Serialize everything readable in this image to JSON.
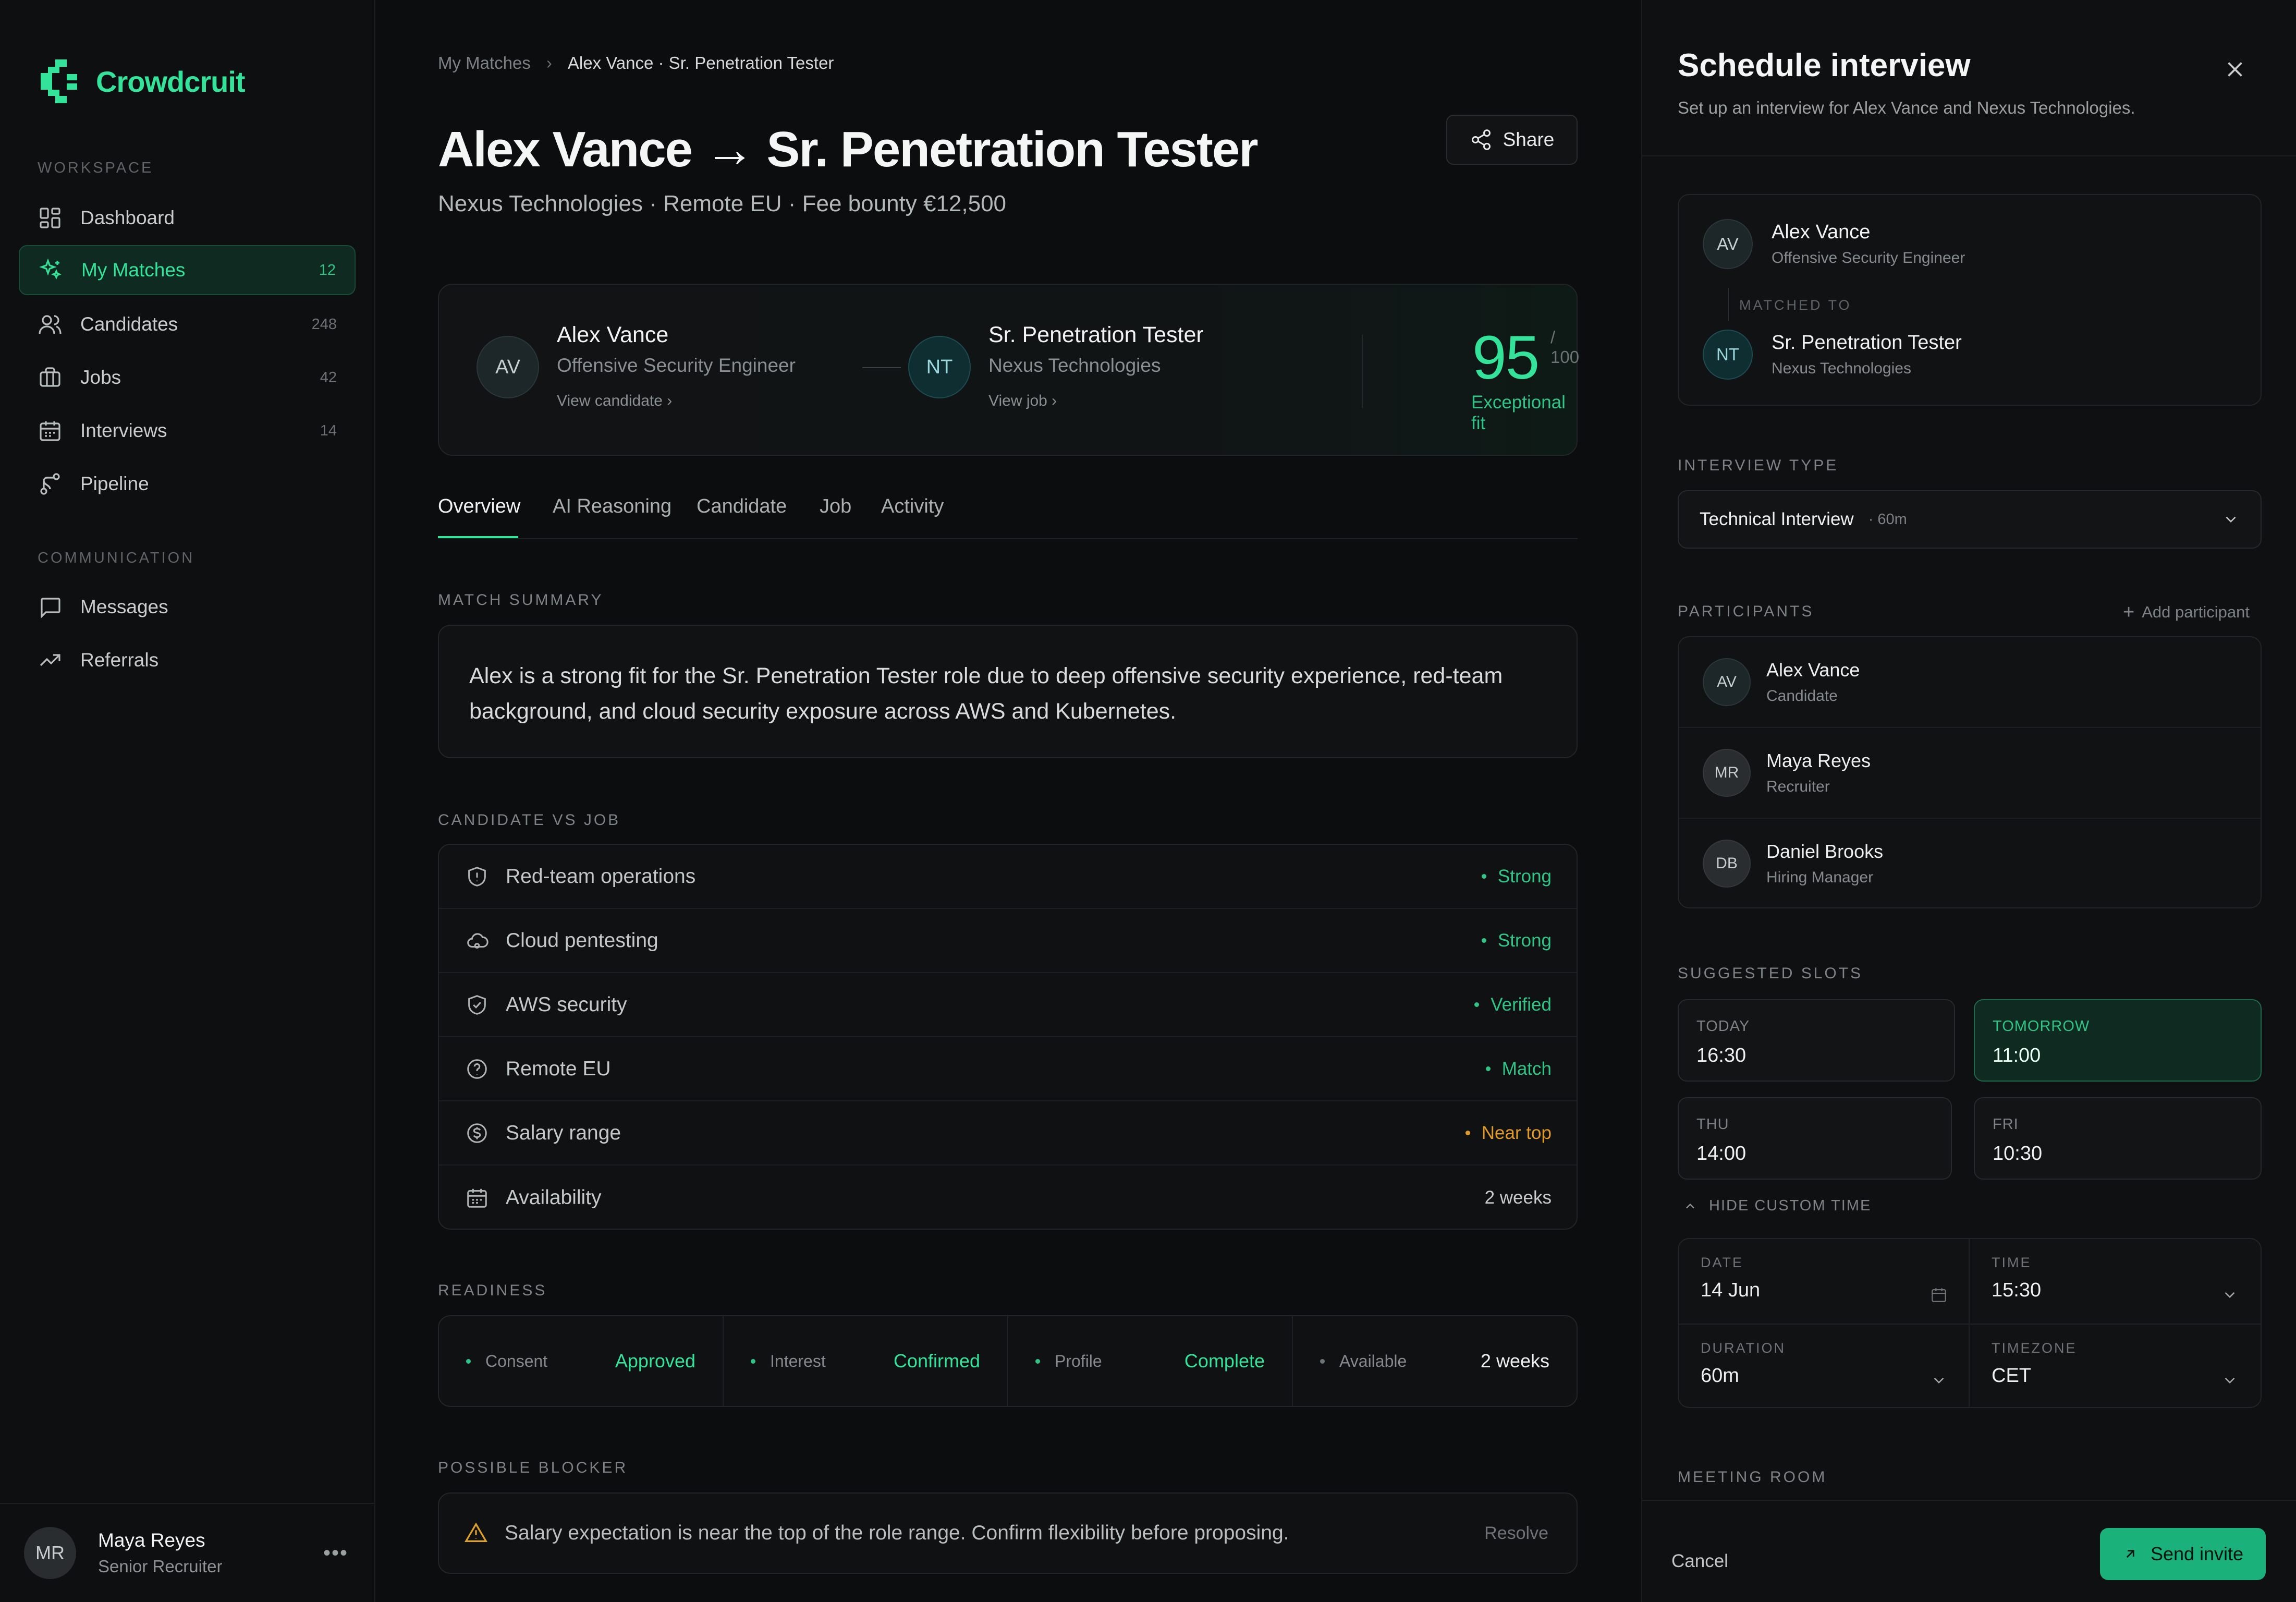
{
  "app": {
    "name": "Crowdcruit",
    "accent": "#34e39a"
  },
  "sidebar": {
    "workspace_label": "WORKSPACE",
    "communication_label": "COMMUNICATION",
    "items": [
      {
        "label": "Dashboard",
        "icon": "dashboard-icon",
        "count": ""
      },
      {
        "label": "My Matches",
        "icon": "sparkle-icon",
        "count": "12"
      },
      {
        "label": "Candidates",
        "icon": "users-icon",
        "count": "248"
      },
      {
        "label": "Jobs",
        "icon": "briefcase-icon",
        "count": "42"
      },
      {
        "label": "Interviews",
        "icon": "calendar-icon",
        "count": "14"
      },
      {
        "label": "Pipeline",
        "icon": "pipeline-icon",
        "count": ""
      }
    ],
    "comm_items": [
      {
        "label": "Messages",
        "icon": "message-icon"
      },
      {
        "label": "Referrals",
        "icon": "trend-icon"
      }
    ],
    "user": {
      "initials": "MR",
      "name": "Maya Reyes",
      "role": "Senior Recruiter",
      "more": "•••"
    }
  },
  "main": {
    "breadcrumb": {
      "parent": "My Matches",
      "sep": "›",
      "current": "Alex Vance · Sr. Penetration Tester"
    },
    "title": "Alex Vance → Sr. Penetration Tester",
    "subtitle": "Nexus Technologies · Remote EU · Fee bounty €12,500",
    "share_label": "Share",
    "match": {
      "candidate": {
        "initials": "AV",
        "name": "Alex Vance",
        "role": "Offensive Security Engineer",
        "link": "View candidate ›"
      },
      "job": {
        "initials": "NT",
        "name": "Sr. Penetration Tester",
        "company": "Nexus Technologies",
        "link": "View job ›"
      },
      "score": "95",
      "out_of": "/ 100",
      "fit": "Exceptional fit"
    },
    "tabs": [
      "Overview",
      "AI Reasoning",
      "Candidate",
      "Job",
      "Activity"
    ],
    "summary_label": "MATCH SUMMARY",
    "summary": "Alex is a strong fit for the Sr. Penetration Tester role due to deep offensive security experience, red-team background, and cloud security exposure across AWS and Kubernetes.",
    "cvj_label": "CANDIDATE VS JOB",
    "cvj": [
      {
        "label": "Red-team operations",
        "value": "Strong",
        "status": "green",
        "icon": "shield-alert-icon"
      },
      {
        "label": "Cloud pentesting",
        "value": "Strong",
        "status": "green",
        "icon": "cloud-icon"
      },
      {
        "label": "AWS security",
        "value": "Verified",
        "status": "green",
        "icon": "shield-check-icon"
      },
      {
        "label": "Remote EU",
        "value": "Match",
        "status": "green",
        "icon": "help-circle-icon"
      },
      {
        "label": "Salary range",
        "value": "Near top",
        "status": "amber",
        "icon": "dollar-icon"
      },
      {
        "label": "Availability",
        "value": "2 weeks",
        "status": "neutral",
        "icon": "calendar-icon"
      }
    ],
    "readiness_label": "READINESS",
    "readiness": [
      {
        "key": "Consent",
        "value": "Approved",
        "tone": "green"
      },
      {
        "key": "Interest",
        "value": "Confirmed",
        "tone": "green"
      },
      {
        "key": "Profile",
        "value": "Complete",
        "tone": "green"
      },
      {
        "key": "Available",
        "value": "2 weeks",
        "tone": "white"
      }
    ],
    "blocker_label": "POSSIBLE BLOCKER",
    "blocker": {
      "text": "Salary expectation is near the top of the role range. Confirm flexibility before proposing.",
      "action": "Resolve"
    }
  },
  "panel": {
    "title": "Schedule interview",
    "subtitle": "Set up an interview for Alex Vance and Nexus Technologies.",
    "match": {
      "a": {
        "initials": "AV",
        "name": "Alex Vance",
        "role": "Offensive Security Engineer"
      },
      "matched_to": "MATCHED TO",
      "b": {
        "initials": "NT",
        "name": "Sr. Penetration Tester",
        "role": "Nexus Technologies"
      }
    },
    "type_label": "INTERVIEW TYPE",
    "type_value": "Technical Interview",
    "type_duration": "· 60m",
    "participants_label": "PARTICIPANTS",
    "add_participant": "Add participant",
    "participants": [
      {
        "initials": "AV",
        "name": "Alex Vance",
        "role": "Candidate"
      },
      {
        "initials": "MR",
        "name": "Maya Reyes",
        "role": "Recruiter"
      },
      {
        "initials": "DB",
        "name": "Daniel Brooks",
        "role": "Hiring Manager"
      }
    ],
    "slots_label": "SUGGESTED SLOTS",
    "slots": [
      {
        "day": "TODAY",
        "time": "16:30",
        "selected": false
      },
      {
        "day": "TOMORROW",
        "time": "11:00",
        "selected": true
      },
      {
        "day": "THU",
        "time": "14:00",
        "selected": false
      },
      {
        "day": "FRI",
        "time": "10:30",
        "selected": false
      }
    ],
    "hide_custom": "HIDE CUSTOM TIME",
    "custom": {
      "date_label": "DATE",
      "date": "14 Jun",
      "time_label": "TIME",
      "time": "15:30",
      "duration_label": "DURATION",
      "duration": "60m",
      "tz_label": "TIMEZONE",
      "tz": "CET"
    },
    "room_label": "MEETING ROOM",
    "cancel": "Cancel",
    "send": "Send invite"
  }
}
